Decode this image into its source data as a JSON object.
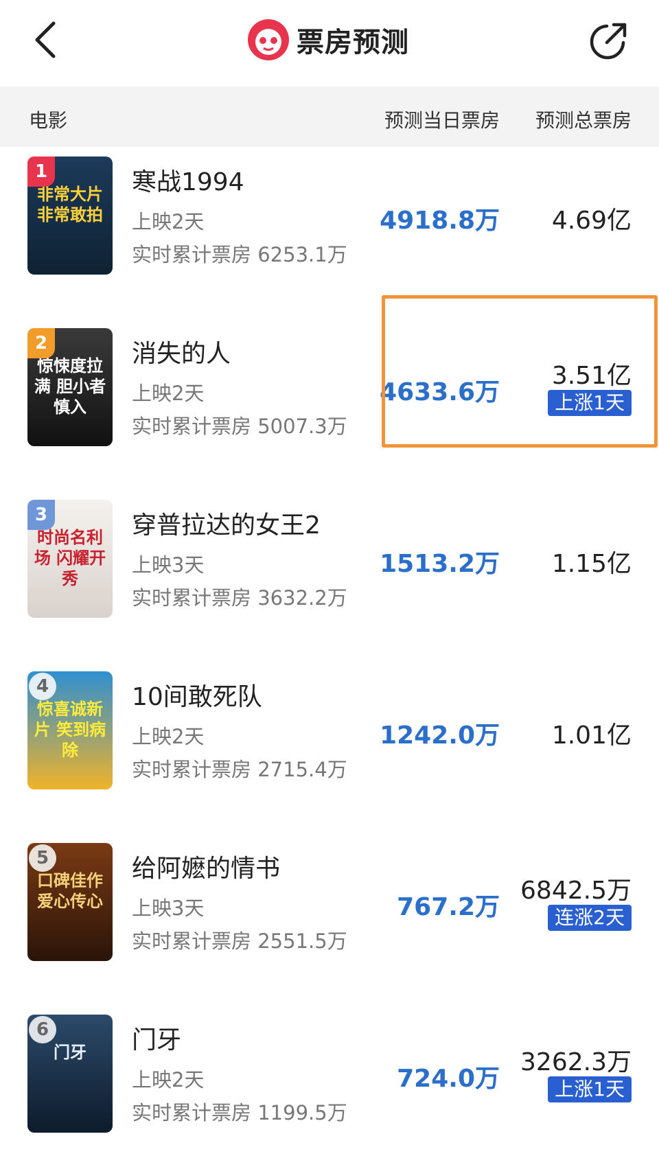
{
  "header": {
    "title": "票房预测",
    "back_icon": "back-arrow-icon",
    "share_icon": "share-icon"
  },
  "columns": {
    "movie": "电影",
    "day": "预测当日票房",
    "total": "预测总票房"
  },
  "movies": [
    {
      "rank": "1",
      "name": "寒战1994",
      "days": "上映2天",
      "cumulative": "实时累计票房 6253.1万",
      "day_forecast": "4918.8万",
      "total_forecast": "4.69亿",
      "badge": "",
      "poster_text": "非常大片 非常敢拍"
    },
    {
      "rank": "2",
      "name": "消失的人",
      "days": "上映2天",
      "cumulative": "实时累计票房 5007.3万",
      "day_forecast": "4633.6万",
      "total_forecast": "3.51亿",
      "badge": "上涨1天",
      "poster_text": "惊悚度拉满 胆小者慎入"
    },
    {
      "rank": "3",
      "name": "穿普拉达的女王2",
      "days": "上映3天",
      "cumulative": "实时累计票房 3632.2万",
      "day_forecast": "1513.2万",
      "total_forecast": "1.15亿",
      "badge": "",
      "poster_text": "时尚名利场 闪耀开秀"
    },
    {
      "rank": "4",
      "name": "10间敢死队",
      "days": "上映2天",
      "cumulative": "实时累计票房 2715.4万",
      "day_forecast": "1242.0万",
      "total_forecast": "1.01亿",
      "badge": "",
      "poster_text": "惊喜诚新片 笑到病除"
    },
    {
      "rank": "5",
      "name": "给阿嬷的情书",
      "days": "上映3天",
      "cumulative": "实时累计票房 2551.5万",
      "day_forecast": "767.2万",
      "total_forecast": "6842.5万",
      "badge": "连涨2天",
      "poster_text": "口碑佳作 爱心传心"
    },
    {
      "rank": "6",
      "name": "门牙",
      "days": "上映2天",
      "cumulative": "实时累计票房 1199.5万",
      "day_forecast": "724.0万",
      "total_forecast": "3262.3万",
      "badge": "上涨1天",
      "poster_text": "门牙"
    }
  ],
  "colors": {
    "accent_blue": "#2b6fcb",
    "badge_blue": "#2a5fd1",
    "highlight_orange": "#f0943a",
    "rank1": "#e8344c",
    "rank2": "#f29c2b",
    "rank3": "#6f96d6"
  }
}
